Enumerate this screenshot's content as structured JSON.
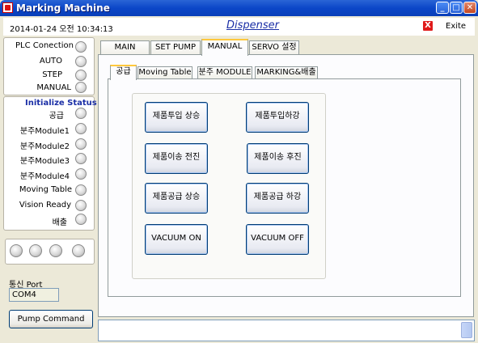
{
  "window": {
    "title": "Marking Machine",
    "minimize": "_",
    "maximize": "□",
    "close": "✕"
  },
  "header": {
    "datetime": "2014-01-24 오전 10:34:13",
    "app_name": "Dispenser",
    "exit_icon": "X",
    "exit_label": "Exite"
  },
  "status_panel": {
    "items": [
      {
        "label": "PLC Conection"
      },
      {
        "label": "AUTO"
      },
      {
        "label": "STEP"
      },
      {
        "label": "MANUAL"
      }
    ]
  },
  "init_panel": {
    "title": "Initialize  Status",
    "items": [
      {
        "label": "공급"
      },
      {
        "label": "분주Module1"
      },
      {
        "label": "분주Module2"
      },
      {
        "label": "분주Module3"
      },
      {
        "label": "분주Module4"
      },
      {
        "label": "Moving Table"
      },
      {
        "label": "Vision Ready"
      },
      {
        "label": "배출"
      }
    ]
  },
  "indicators": {
    "count": 4
  },
  "port": {
    "label": "통신 Port",
    "value": "COM4"
  },
  "pump_command": {
    "label": "Pump Command"
  },
  "tabs": [
    {
      "label": "MAIN"
    },
    {
      "label": "SET PUMP"
    },
    {
      "label": "MANUAL",
      "active": true
    },
    {
      "label": "SERVO 설정"
    }
  ],
  "subtabs": [
    {
      "label": "공급",
      "active": true
    },
    {
      "label": "Moving Table"
    },
    {
      "label": "분주 MODULE"
    },
    {
      "label": "MARKING&배출"
    }
  ],
  "actions": {
    "feed_up": "제품투입 상승",
    "feed_down": "제품투입하강",
    "transfer_forward": "제품이송 전진",
    "transfer_back": "제품이송 후진",
    "supply_up": "제품공급 상승",
    "supply_down": "제품공급 하강",
    "vacuum_on": "VACUUM ON",
    "vacuum_off": "VACUUM OFF"
  },
  "colors": {
    "titlebar": "#0b46c8",
    "accent_text": "#1b2fa6",
    "exit_red": "#e01a1a",
    "tab_highlight": "#ffc83c"
  }
}
